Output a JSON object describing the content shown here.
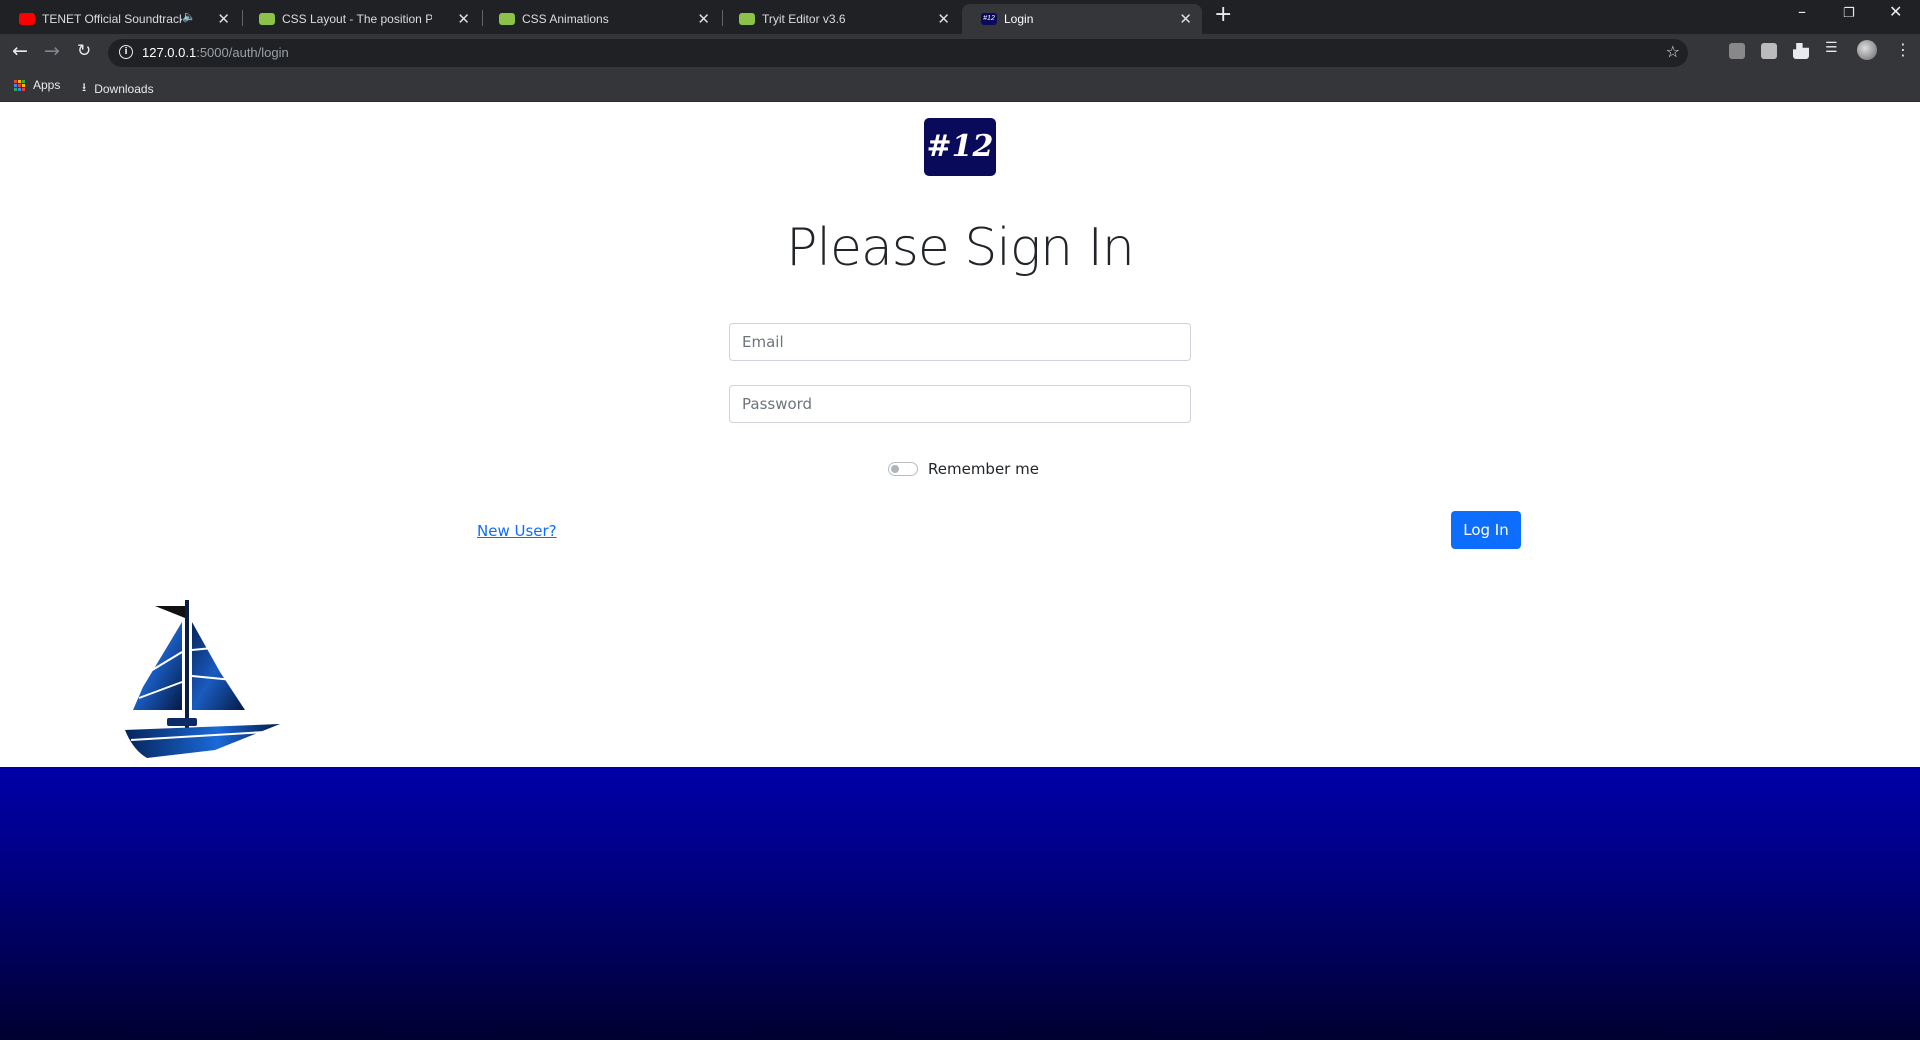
{
  "browser": {
    "tabs": [
      {
        "title": "TENET Official Soundtrack | F",
        "favicon": "youtube-icon",
        "color": "#ff0000",
        "audio": true
      },
      {
        "title": "CSS Layout - The position Proper",
        "favicon": "w3schools-icon",
        "color": "#8bc34a"
      },
      {
        "title": "CSS Animations",
        "favicon": "w3schools-icon",
        "color": "#8bc34a"
      },
      {
        "title": "Tryit Editor v3.6",
        "favicon": "w3schools-icon",
        "color": "#8bc34a"
      },
      {
        "title": "Login",
        "favicon": "site-logo-icon",
        "color": "#0a0a5a",
        "active": true
      }
    ],
    "url_host": "127.0.0.1",
    "url_rest": ":5000/auth/login",
    "bookmarks": [
      {
        "label": "Apps",
        "icon": "apps-grid-icon"
      },
      {
        "label": "Downloads",
        "icon": "download-icon"
      }
    ]
  },
  "page": {
    "logo_text": "#12",
    "heading": "Please Sign In",
    "email_placeholder": "Email",
    "password_placeholder": "Password",
    "remember_label": "Remember me",
    "new_user_link": "New User?",
    "login_button": "Log In"
  },
  "colors": {
    "primary": "#0d6efd",
    "sea": "#0000a8",
    "logo_bg": "#0a0a5a"
  }
}
